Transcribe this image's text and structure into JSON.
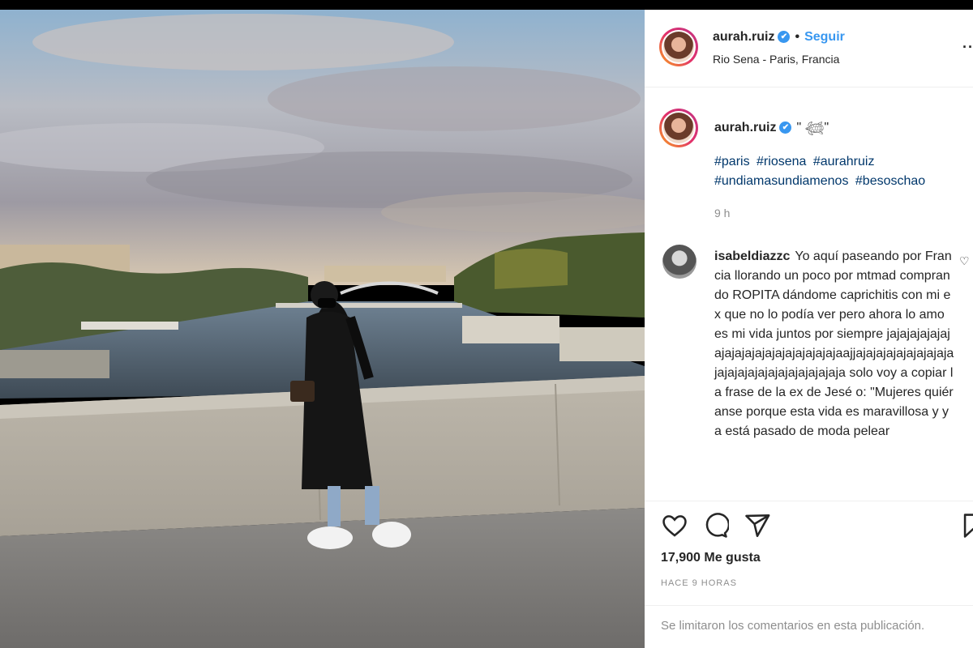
{
  "post": {
    "username": "aurah.ruiz",
    "verified": "✔",
    "follow_label": "Seguir",
    "location": "Rio Sena - Paris, Francia",
    "caption": "\" 𓆉\"",
    "hashtags": [
      "#paris",
      "#riosena",
      "#aurahruiz",
      "#undiamasundiamenos",
      "#besoschao"
    ],
    "caption_time": "9 h",
    "likes": "17,900 Me gusta",
    "posted_ago": "HACE 9 HORAS",
    "comments_limited": "Se limitaron los comentarios en esta publicación."
  },
  "comment": {
    "username": "isabeldiazzc",
    "text": "Yo aquí paseando por Francia llorando un poco por mtmad comprando ROPITA dándome caprichitis con mi ex que no lo podía ver pero ahora lo amo es mi vida juntos por siempre jajajajajajajajajajajajajajajajajajajaajjajajajajajajajajajajajajajajajajajajajajajaja solo voy a copiar la frase de la ex de Jesé o: \"Mujeres quiéranse porque esta vida es maravillosa y ya está pasado de moda pelear"
  },
  "icons": {
    "more": "more-options-icon",
    "like": "heart-icon",
    "comment": "comment-icon",
    "share": "share-icon",
    "save": "bookmark-icon",
    "comment_like": "small-heart-icon"
  },
  "colors": {
    "link_blue": "#3897f0",
    "hashtag": "#00376b",
    "muted": "#8e8e8e"
  }
}
